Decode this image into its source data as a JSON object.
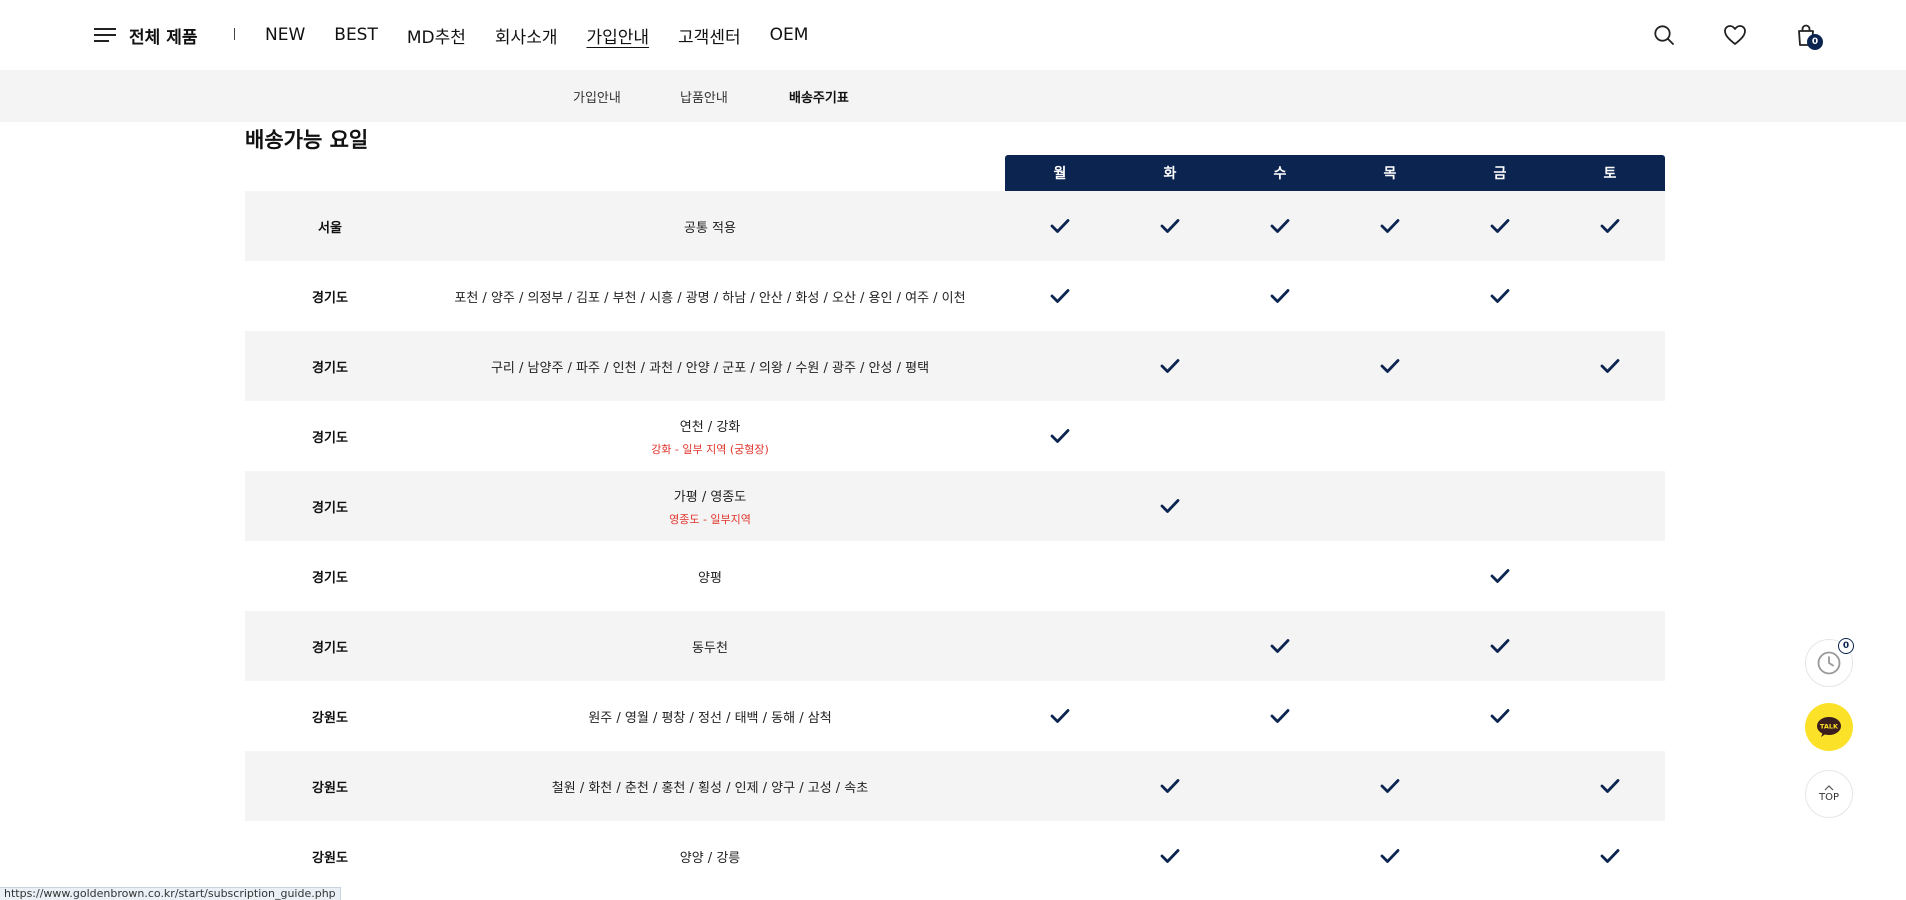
{
  "header": {
    "menu_label": "전체 제품",
    "nav": [
      {
        "label": "NEW",
        "active": false
      },
      {
        "label": "BEST",
        "active": false
      },
      {
        "label": "MD추천",
        "active": false
      },
      {
        "label": "회사소개",
        "active": false
      },
      {
        "label": "가입안내",
        "active": true
      },
      {
        "label": "고객센터",
        "active": false
      },
      {
        "label": "OEM",
        "active": false
      }
    ],
    "icons": {
      "search": "search-icon",
      "wishlist": "heart-icon",
      "cart": "shopping-bag-icon"
    },
    "cart_count": "0"
  },
  "subnav": {
    "items": [
      {
        "label": "가입안내",
        "active": false
      },
      {
        "label": "납품안내",
        "active": false
      },
      {
        "label": "배송주기표",
        "active": true
      }
    ]
  },
  "section": {
    "title": "배송가능 요일"
  },
  "schedule": {
    "days": [
      "월",
      "화",
      "수",
      "목",
      "금",
      "토"
    ],
    "rows": [
      {
        "region": "서울",
        "areas": "공통 적용",
        "note": "",
        "checks": [
          true,
          true,
          true,
          true,
          true,
          true
        ]
      },
      {
        "region": "경기도",
        "areas": "포천 / 양주 / 의정부 / 김포 / 부천 / 시흥 / 광명 / 하남 / 안산 / 화성 / 오산 / 용인 / 여주 / 이천",
        "note": "",
        "checks": [
          true,
          false,
          true,
          false,
          true,
          false
        ]
      },
      {
        "region": "경기도",
        "areas": "구리 / 남양주 / 파주 / 인천 / 과천 / 안양 / 군포 / 의왕 / 수원 / 광주 / 안성 / 평택",
        "note": "",
        "checks": [
          false,
          true,
          false,
          true,
          false,
          true
        ]
      },
      {
        "region": "경기도",
        "areas": "연천 / 강화",
        "note": "강화 - 일부 지역 (궁형장)",
        "checks": [
          true,
          false,
          false,
          false,
          false,
          false
        ]
      },
      {
        "region": "경기도",
        "areas": "가평 / 영종도",
        "note": "영종도 - 일부지역",
        "checks": [
          false,
          true,
          false,
          false,
          false,
          false
        ]
      },
      {
        "region": "경기도",
        "areas": "양평",
        "note": "",
        "checks": [
          false,
          false,
          false,
          false,
          true,
          false
        ]
      },
      {
        "region": "경기도",
        "areas": "동두천",
        "note": "",
        "checks": [
          false,
          false,
          true,
          false,
          true,
          false
        ]
      },
      {
        "region": "강원도",
        "areas": "원주 / 영월 / 평창 / 정선 / 태백 / 동해 / 삼척",
        "note": "",
        "checks": [
          true,
          false,
          true,
          false,
          true,
          false
        ]
      },
      {
        "region": "강원도",
        "areas": "철원 / 화천 / 춘천 / 홍천 / 횡성 / 인제 / 양구 / 고성 / 속초",
        "note": "",
        "checks": [
          false,
          true,
          false,
          true,
          false,
          true
        ]
      },
      {
        "region": "강원도",
        "areas": "양양 / 강릉",
        "note": "",
        "checks": [
          false,
          true,
          false,
          true,
          false,
          true
        ]
      }
    ]
  },
  "floating": {
    "recent_count": "0",
    "talk_label": "TALK",
    "top_label": "TOP"
  },
  "status_bar": {
    "url": "https://www.goldenbrown.co.kr/start/subscription_guide.php"
  },
  "colors": {
    "navy": "#0b2450",
    "row_alt": "#f4f4f4",
    "note_red": "#e0332b",
    "kakao_yellow": "#fbe228"
  }
}
